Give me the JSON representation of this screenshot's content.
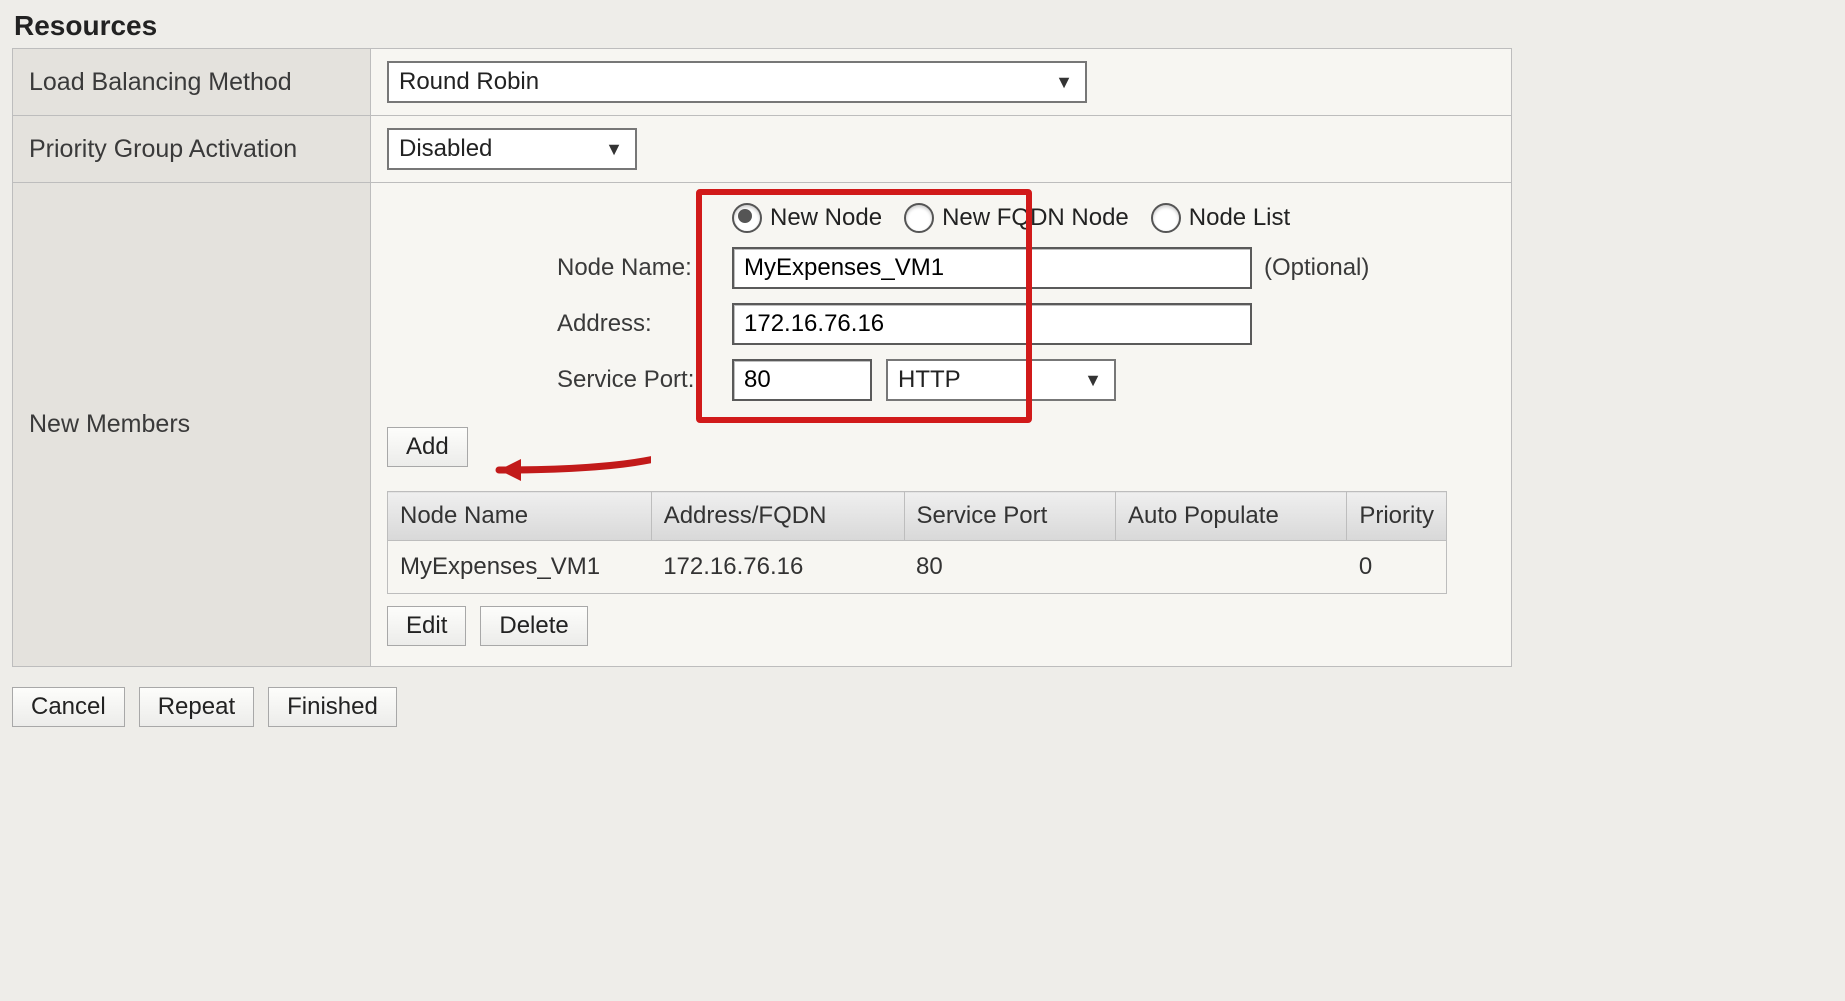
{
  "section": {
    "title": "Resources"
  },
  "labels": {
    "lb_method": "Load Balancing Method",
    "priority_group": "Priority Group Activation",
    "new_members": "New Members",
    "node_name": "Node Name:",
    "address": "Address:",
    "service_port": "Service Port:",
    "optional": "(Optional)"
  },
  "selects": {
    "lb_method_value": "Round Robin",
    "priority_group_value": "Disabled",
    "port_proto_value": "HTTP"
  },
  "radios": {
    "new_node": "New Node",
    "new_fqdn": "New FQDN Node",
    "node_list": "Node List"
  },
  "inputs": {
    "node_name": "MyExpenses_VM1",
    "address": "172.16.76.16",
    "port": "80"
  },
  "buttons": {
    "add": "Add",
    "edit": "Edit",
    "delete": "Delete",
    "cancel": "Cancel",
    "repeat": "Repeat",
    "finished": "Finished"
  },
  "table": {
    "headers": {
      "node_name": "Node Name",
      "address": "Address/FQDN",
      "service_port": "Service Port",
      "auto_populate": "Auto Populate",
      "priority": "Priority"
    },
    "rows": [
      {
        "node_name": "MyExpenses_VM1",
        "address": "172.16.76.16",
        "service_port": "80",
        "auto_populate": "",
        "priority": "0"
      }
    ]
  }
}
